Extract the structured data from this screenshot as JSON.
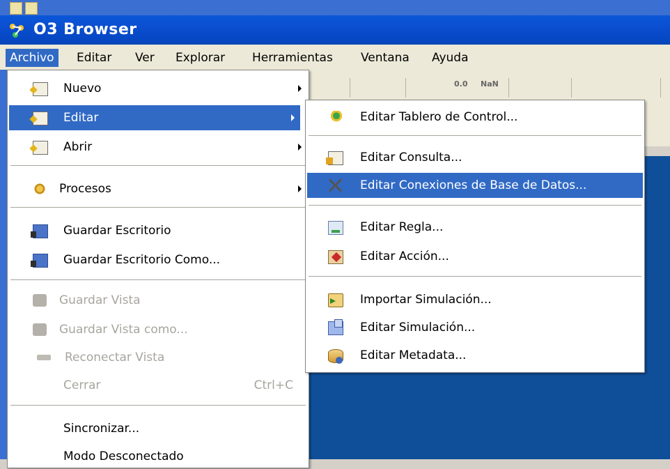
{
  "window": {
    "title": "O3 Browser"
  },
  "menubar": {
    "items": [
      "Archivo",
      "Editar",
      "Ver",
      "Explorar",
      "Herramientas",
      "Ventana",
      "Ayuda"
    ],
    "active_index": 0
  },
  "toolbar": {
    "labels": [
      "0.0",
      "NaN"
    ]
  },
  "archivo_menu": {
    "items": [
      {
        "label": "Nuevo",
        "icon": "new-document-icon",
        "submenu": true
      },
      {
        "label": "Editar",
        "icon": "edit-document-icon",
        "submenu": true,
        "active": true
      },
      {
        "label": "Abrir",
        "icon": "open-document-icon",
        "submenu": true
      },
      {
        "label": "Procesos",
        "icon": "process-gears-icon",
        "submenu": true
      },
      {
        "label": "Guardar Escritorio",
        "icon": "save-desktop-icon"
      },
      {
        "label": "Guardar Escritorio Como...",
        "icon": "save-desktop-as-icon"
      },
      {
        "label": "Guardar Vista",
        "icon": "camera-icon",
        "disabled": true
      },
      {
        "label": "Guardar Vista como...",
        "icon": "camera-icon",
        "disabled": true
      },
      {
        "label": "Reconectar Vista",
        "icon": "plug-icon",
        "disabled": true
      },
      {
        "label": "Cerrar",
        "shortcut": "Ctrl+C",
        "disabled": true
      },
      {
        "label": "Sincronizar..."
      },
      {
        "label": "Modo Desconectado"
      }
    ]
  },
  "editar_submenu": {
    "items": [
      {
        "label": "Editar Tablero de Control...",
        "icon": "dashboard-icon"
      },
      {
        "label": "Editar Consulta...",
        "icon": "query-icon"
      },
      {
        "label": "Editar Conexiones de Base de Datos...",
        "icon": "database-connection-icon",
        "active": true
      },
      {
        "label": "Editar Regla...",
        "icon": "rule-icon"
      },
      {
        "label": "Editar Acción...",
        "icon": "action-icon"
      },
      {
        "label": "Importar Simulación...",
        "icon": "import-simulation-icon"
      },
      {
        "label": "Editar Simulación...",
        "icon": "simulation-icon"
      },
      {
        "label": "Editar Metadata...",
        "icon": "metadata-icon"
      }
    ]
  },
  "colors": {
    "title_bar": "#0a4fd0",
    "menu_highlight": "#316ac5",
    "disabled_text": "#a7a59e",
    "workspace": "#0f4f9a"
  }
}
